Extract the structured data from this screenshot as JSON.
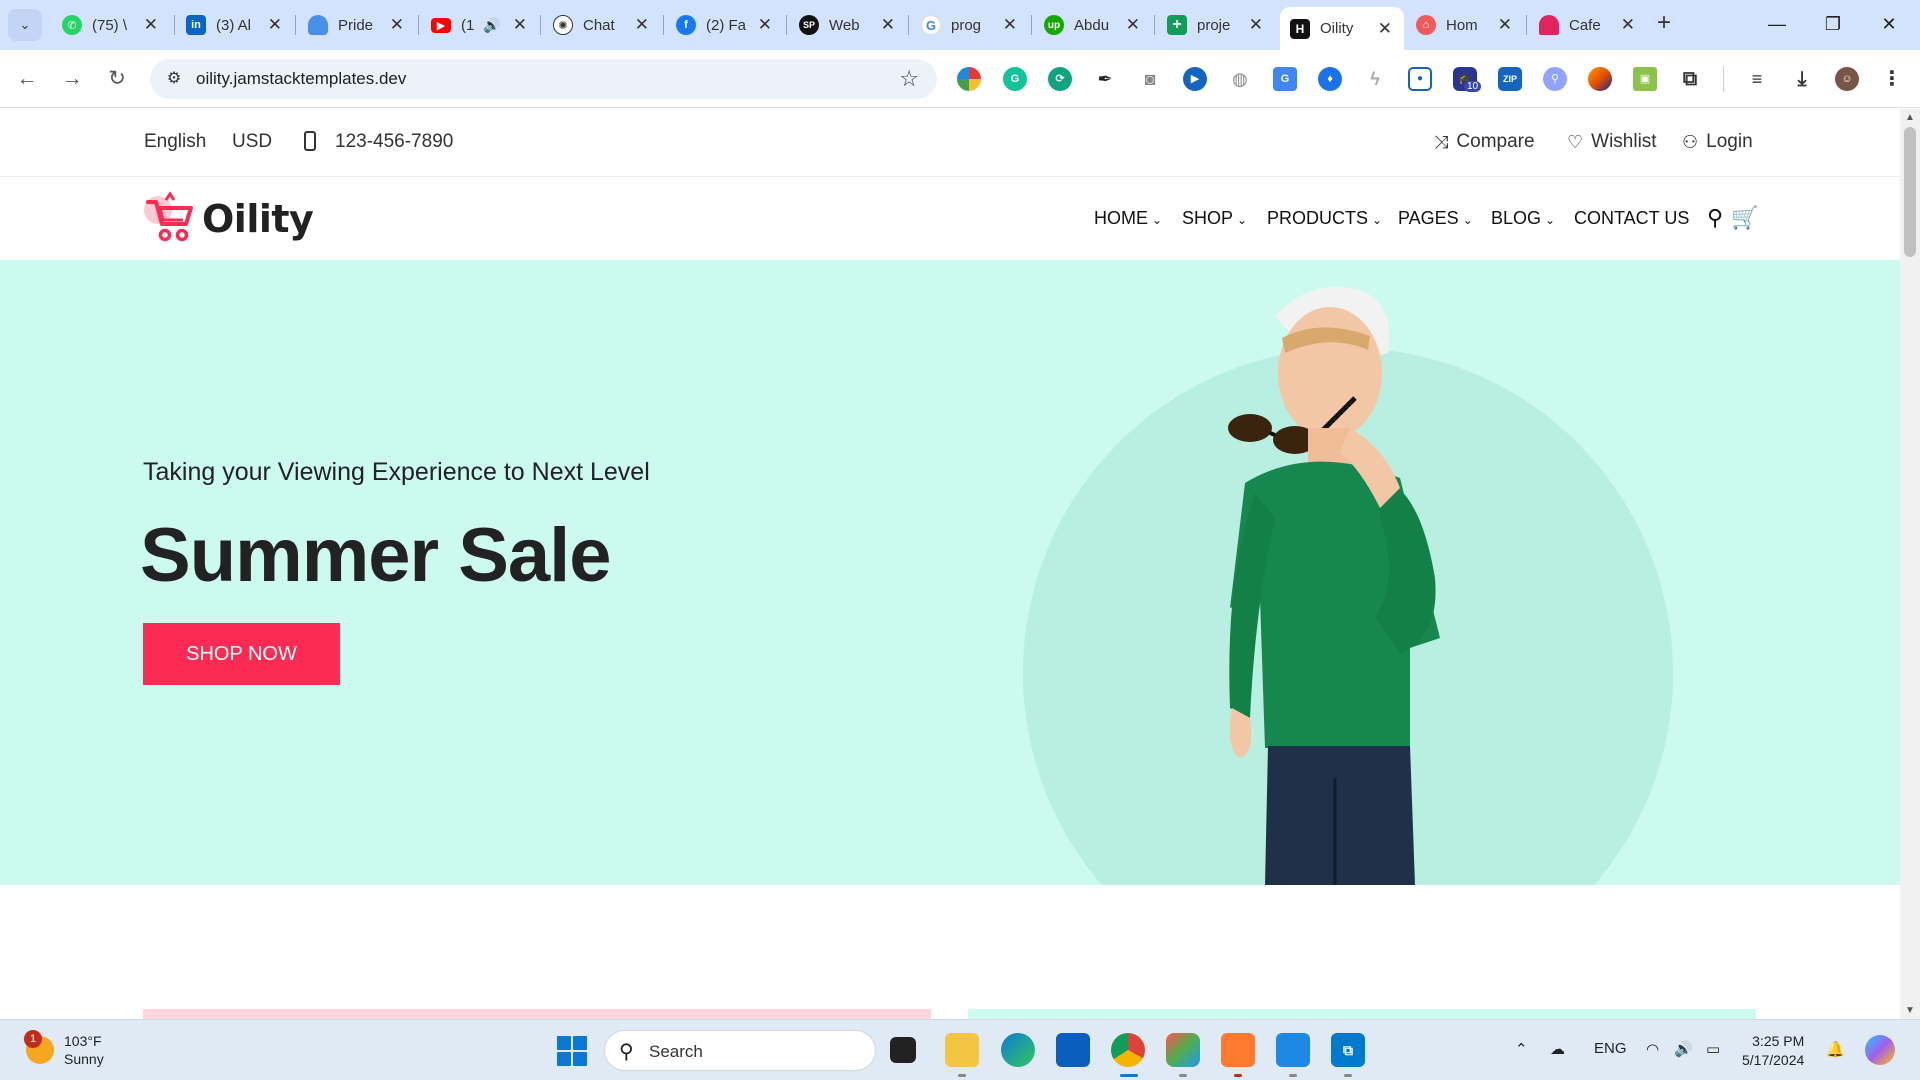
{
  "browser": {
    "tabs": [
      {
        "title": "(75) \\",
        "favicon": "whatsapp-icon",
        "color": "#25d366"
      },
      {
        "title": "(3) Al",
        "favicon": "linkedin-icon",
        "color": "#0a66c2"
      },
      {
        "title": "Pride",
        "favicon": "cloud-icon",
        "color": "#4a8fe7"
      },
      {
        "title": "(1",
        "favicon": "youtube-icon",
        "color": "#ff0000"
      },
      {
        "title": "Chat",
        "favicon": "chatgpt-icon",
        "color": "#333333"
      },
      {
        "title": "(2) Fa",
        "favicon": "facebook-icon",
        "color": "#1877f2"
      },
      {
        "title": "Web",
        "favicon": "sp-icon",
        "color": "#111111"
      },
      {
        "title": "prog",
        "favicon": "google-icon",
        "color": "#4285f4"
      },
      {
        "title": "Abdu",
        "favicon": "upwork-icon",
        "color": "#14a800"
      },
      {
        "title": "proje",
        "favicon": "sheets-icon",
        "color": "#0f9d58"
      },
      {
        "title": "Oility",
        "favicon": "oility-icon",
        "color": "#111111",
        "active": true
      },
      {
        "title": "Hom",
        "favicon": "home-icon",
        "color": "#ef5b5b"
      },
      {
        "title": "Cafe",
        "favicon": "cafe-icon",
        "color": "#e0245e"
      }
    ],
    "url": "oility.jamstacktemplates.dev",
    "extension_badge": "10",
    "zip_label": "ZIP"
  },
  "site": {
    "topbar": {
      "language": "English",
      "currency": "USD",
      "phone": "123-456-7890",
      "compare": "Compare",
      "wishlist": "Wishlist",
      "login": "Login"
    },
    "logo_text": "Oility",
    "nav": {
      "home": "HOME",
      "shop": "SHOP",
      "products": "PRODUCTS",
      "pages": "PAGES",
      "blog": "BLOG",
      "contact": "CONTACT US"
    },
    "hero": {
      "subtitle": "Taking your Viewing Experience to Next Level",
      "title": "Summer Sale",
      "cta": "SHOP NOW",
      "accent_color": "#fb2b54",
      "bg_color": "#ccfaee"
    }
  },
  "taskbar": {
    "weather_temp": "103°F",
    "weather_desc": "Sunny",
    "weather_badge": "1",
    "search_label": "Search",
    "language": "ENG",
    "time": "3:25 PM",
    "date": "5/17/2024"
  }
}
